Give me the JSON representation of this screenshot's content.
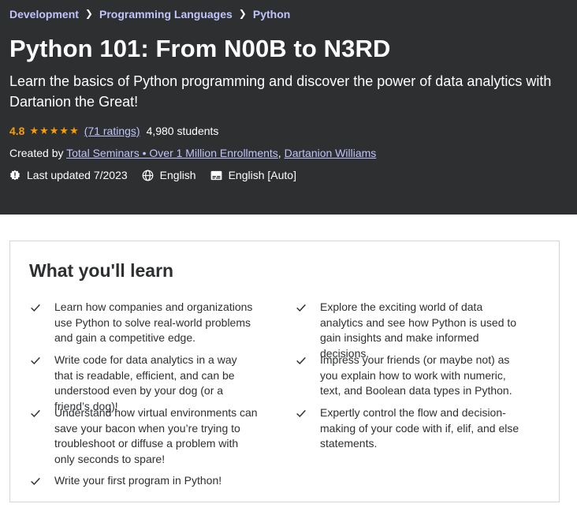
{
  "breadcrumb": [
    "Development",
    "Programming Languages",
    "Python"
  ],
  "course": {
    "title": "Python 101: From N00B to N3RD",
    "subtitle": "Learn the basics of Python programming and discover the power of data analytics with Dartanion the Great!",
    "rating": "4.8",
    "stars": "★★★★★",
    "star_fill": 4.8,
    "ratings_link": "(71 ratings)",
    "students": "4,980 students",
    "created_by_label": "Created by",
    "instructors": [
      "Total Seminars • Over 1 Million Enrollments",
      "Dartanion Williams"
    ],
    "instructor_separator": ", ",
    "last_updated": "Last updated 7/2023",
    "language": "English",
    "captions": "English [Auto]"
  },
  "icons": {
    "breadcrumb_separator": "chevron-right-icon",
    "last_updated": "alert-badge-icon",
    "language": "globe-icon",
    "captions": "closed-captions-icon",
    "check": "check-icon"
  },
  "colors": {
    "hero_bg": "#2d2f31",
    "link": "#c0c4fc",
    "rating": "#f69c08",
    "text": "#2d2f31",
    "border": "#d1d7dc"
  },
  "learn": {
    "title": "What you'll learn",
    "items": [
      "Learn how companies and organizations use Python to solve real-world problems and gain a competitive edge.",
      "Explore the exciting world of data analytics and see how Python is used to gain insights and make informed decisions.",
      "Write code for data analytics in a way that is readable, efficient, and can be understood even by your dog (or a friend’s dog)!",
      "Impress your friends (or maybe not) as you explain how to work with numeric, text, and Boolean data types in Python.",
      "Understand how virtual environments can save your bacon when you’re trying to troubleshoot or diffuse a problem with only seconds to spare!",
      "Expertly control the flow and decision-making of your code with if, elif, and else statements.",
      "Write your first program in Python!"
    ]
  }
}
